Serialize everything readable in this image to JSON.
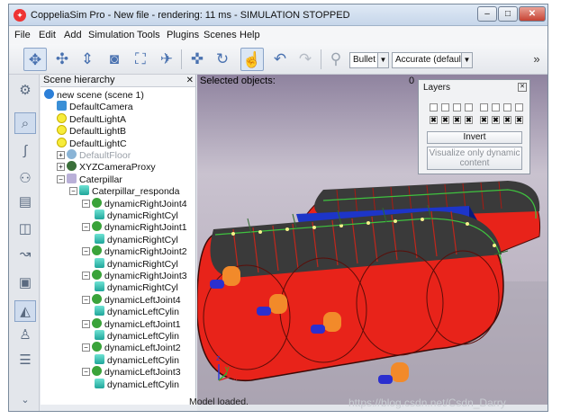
{
  "window": {
    "title": "CoppeliaSim Pro    - New file - rendering: 11 ms - SIMULATION STOPPED",
    "minimize": "–",
    "maximize": "□",
    "close": "✕"
  },
  "menu": [
    "File",
    "Edit",
    "Add",
    "Simulation",
    "Tools",
    "Plugins",
    "Scenes",
    "Help"
  ],
  "toolbar": {
    "engine": "Bullet",
    "accuracy": "Accurate (default)",
    "overflow": "»"
  },
  "hierarchy": {
    "title": "Scene hierarchy",
    "close": "✕",
    "rows": [
      {
        "label": "new scene (scene 1)",
        "icon": "scene",
        "indent": 0,
        "exp": ""
      },
      {
        "label": "DefaultCamera",
        "icon": "cam",
        "indent": 1,
        "exp": ""
      },
      {
        "label": "DefaultLightA",
        "icon": "light",
        "indent": 1,
        "exp": ""
      },
      {
        "label": "DefaultLightB",
        "icon": "light",
        "indent": 1,
        "exp": ""
      },
      {
        "label": "DefaultLightC",
        "icon": "light",
        "indent": 1,
        "exp": ""
      },
      {
        "label": "DefaultFloor",
        "icon": "floor",
        "indent": 1,
        "exp": "+",
        "dim": true
      },
      {
        "label": "XYZCameraProxy",
        "icon": "proxy",
        "indent": 1,
        "exp": "+"
      },
      {
        "label": "Caterpillar",
        "icon": "model",
        "indent": 1,
        "exp": "−"
      },
      {
        "label": "Caterpillar_responda",
        "icon": "cyl",
        "indent": 2,
        "exp": "−"
      },
      {
        "label": "dynamicRightJoint4",
        "icon": "joint",
        "indent": 3,
        "exp": "−"
      },
      {
        "label": "dynamicRightCyl",
        "icon": "cyl",
        "indent": 4,
        "exp": ""
      },
      {
        "label": "dynamicRightJoint1",
        "icon": "joint",
        "indent": 3,
        "exp": "−"
      },
      {
        "label": "dynamicRightCyl",
        "icon": "cyl",
        "indent": 4,
        "exp": ""
      },
      {
        "label": "dynamicRightJoint2",
        "icon": "joint",
        "indent": 3,
        "exp": "−"
      },
      {
        "label": "dynamicRightCyl",
        "icon": "cyl",
        "indent": 4,
        "exp": ""
      },
      {
        "label": "dynamicRightJoint3",
        "icon": "joint",
        "indent": 3,
        "exp": "−"
      },
      {
        "label": "dynamicRightCyl",
        "icon": "cyl",
        "indent": 4,
        "exp": ""
      },
      {
        "label": "dynamicLeftJoint4",
        "icon": "joint",
        "indent": 3,
        "exp": "−"
      },
      {
        "label": "dynamicLeftCylin",
        "icon": "cyl",
        "indent": 4,
        "exp": ""
      },
      {
        "label": "dynamicLeftJoint1",
        "icon": "joint",
        "indent": 3,
        "exp": "−"
      },
      {
        "label": "dynamicLeftCylin",
        "icon": "cyl",
        "indent": 4,
        "exp": ""
      },
      {
        "label": "dynamicLeftJoint2",
        "icon": "joint",
        "indent": 3,
        "exp": "−"
      },
      {
        "label": "dynamicLeftCylin",
        "icon": "cyl",
        "indent": 4,
        "exp": ""
      },
      {
        "label": "dynamicLeftJoint3",
        "icon": "joint",
        "indent": 3,
        "exp": "−"
      },
      {
        "label": "dynamicLeftCylin",
        "icon": "cyl",
        "indent": 4,
        "exp": ""
      }
    ]
  },
  "viewport": {
    "selected_label": "Selected objects:",
    "selected_count": "0",
    "axes": {
      "x": "x",
      "y": "y",
      "z": "z"
    }
  },
  "layers": {
    "title": "Layers",
    "close": "✕",
    "invert": "Invert",
    "visualize": "Visualize only dynamic content",
    "marks": "✖"
  },
  "status": "Model loaded.",
  "watermark": "https://blog.csdn.net/Csdn_Darry",
  "colors": {
    "track_red": "#e8231a",
    "belt_blue": "#1d35c8",
    "link_dark": "#3a3a3a"
  }
}
